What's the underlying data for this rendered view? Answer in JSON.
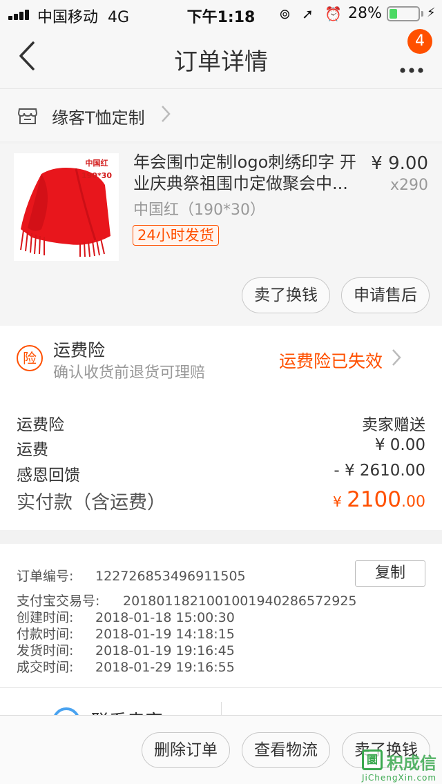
{
  "status_bar": {
    "carrier": "中国移动",
    "network": "4G",
    "time": "下午1:18",
    "battery_percent": "28%",
    "battery_level": 0.28,
    "icons": [
      "orientation-lock-icon",
      "location-icon",
      "alarm-icon",
      "charging-icon"
    ]
  },
  "nav": {
    "title": "订单详情",
    "badge_count": "4"
  },
  "shop": {
    "name": "缘客T恤定制"
  },
  "product": {
    "title": "年会围巾定制logo刺绣印字 开业庆典祭祖围巾定做聚会中...",
    "price": "¥ 9.00",
    "quantity": "x290",
    "sku": "中国红（190*30）",
    "ship_tag": "24小时发货",
    "image_tag_line1": "中国红",
    "image_tag_line2": "190*30",
    "image_color": "#e8161c",
    "actions": [
      "卖了换钱",
      "申请售后"
    ]
  },
  "insurance": {
    "icon_label": "险",
    "title": "运费险",
    "subtitle": "确认收货前退货可理赔",
    "status": "运费险已失效"
  },
  "fees": {
    "rows": [
      {
        "label": "运费险",
        "value": "卖家赠送"
      },
      {
        "label": "运费",
        "value": "¥ 0.00"
      },
      {
        "label": "感恩回馈",
        "value": "- ¥ 2610.00"
      }
    ],
    "total_label": "实付款（含运费）",
    "total_currency": "¥",
    "total_int": "2100",
    "total_dec": ".00"
  },
  "order_info": {
    "order_no_label": "订单编号:",
    "order_no": "122726853496911505",
    "copy_label": "复制",
    "alipay_label": "支付宝交易号:",
    "alipay_no": "2018011821001001940286572925",
    "created_label": "创建时间:",
    "created": "2018-01-18 15:00:30",
    "paid_label": "付款时间:",
    "paid": "2018-01-19 14:18:15",
    "shipped_label": "发货时间:",
    "shipped": "2018-01-19 19:16:45",
    "done_label": "成交时间:",
    "done": "2018-01-29 19:16:55"
  },
  "contact": {
    "label": "联系卖家"
  },
  "bottom_actions": [
    "删除订单",
    "查看物流",
    "卖了换钱"
  ],
  "watermark": {
    "logo": "圜",
    "name": "积成信",
    "url": "JiChengXin.com"
  },
  "colors": {
    "accent": "#ff5000",
    "text": "#333333",
    "muted": "#999999"
  }
}
